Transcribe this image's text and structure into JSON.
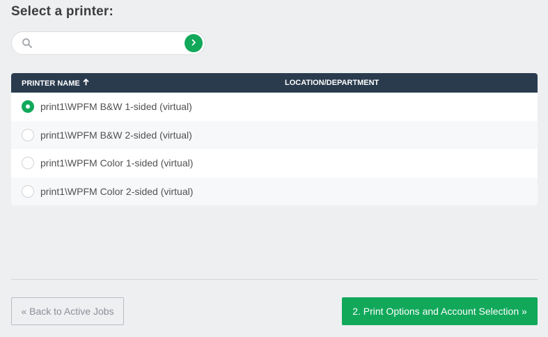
{
  "page": {
    "title": "Select a printer:"
  },
  "search": {
    "value": "",
    "placeholder": "",
    "icon": "search-icon",
    "go_icon": "chevron-right-icon"
  },
  "table": {
    "columns": {
      "name": "PRINTER NAME",
      "location": "LOCATION/DEPARTMENT"
    },
    "sort": "ascending",
    "rows": [
      {
        "name": "print1\\WPFM B&W 1-sided (virtual)",
        "location": "",
        "selected": true
      },
      {
        "name": "print1\\WPFM B&W 2-sided (virtual)",
        "location": "",
        "selected": false
      },
      {
        "name": "print1\\WPFM Color 1-sided (virtual)",
        "location": "",
        "selected": false
      },
      {
        "name": "print1\\WPFM Color 2-sided (virtual)",
        "location": "",
        "selected": false
      }
    ]
  },
  "footer": {
    "back_label": "« Back to Active Jobs",
    "next_label": "2. Print Options and Account Selection »"
  },
  "colors": {
    "accent": "#11a85a",
    "header_bg": "#2a3b4e",
    "page_bg": "#eeeff1"
  }
}
